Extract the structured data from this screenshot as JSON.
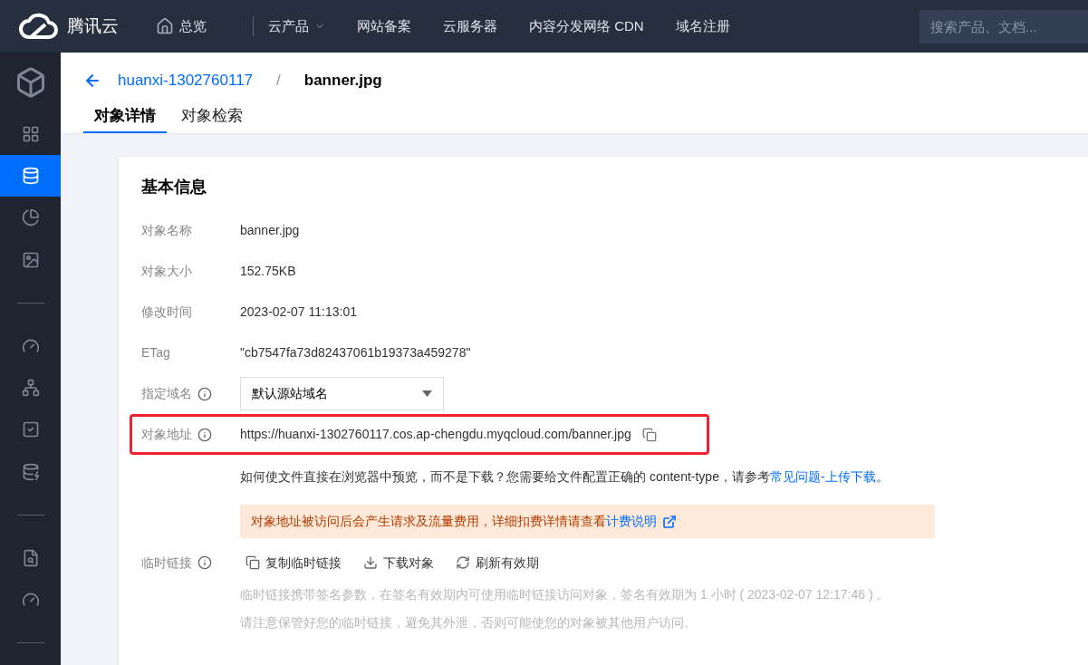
{
  "topbar": {
    "logo": "腾讯云",
    "nav": [
      {
        "label": "总览",
        "kind": "home"
      },
      {
        "kind": "divider"
      },
      {
        "label": "云产品",
        "kind": "dropdown"
      },
      {
        "label": "网站备案",
        "kind": "plain"
      },
      {
        "label": "云服务器",
        "kind": "plain"
      },
      {
        "label": "内容分发网络 CDN",
        "kind": "plain"
      },
      {
        "label": "域名注册",
        "kind": "plain"
      }
    ],
    "search": {
      "placeholder": "搜索产品、文档..."
    }
  },
  "sidebar": {
    "items": [
      {
        "kind": "logo",
        "selected": false
      },
      {
        "kind": "icon",
        "selected": false
      },
      {
        "kind": "icon",
        "selected": true
      },
      {
        "kind": "icon",
        "selected": false
      },
      {
        "kind": "icon",
        "selected": false
      },
      {
        "kind": "divider"
      },
      {
        "kind": "icon",
        "selected": false
      },
      {
        "kind": "icon",
        "selected": false
      },
      {
        "kind": "icon",
        "selected": false
      },
      {
        "kind": "icon",
        "selected": false
      },
      {
        "kind": "divider"
      },
      {
        "kind": "icon",
        "selected": false
      },
      {
        "kind": "icon",
        "selected": false
      },
      {
        "kind": "divider"
      }
    ]
  },
  "breadcrumb": {
    "bucket": "huanxi-1302760117",
    "separator": "/",
    "current": "banner.jpg"
  },
  "tabs": [
    {
      "label": "对象详情",
      "selected": true
    },
    {
      "label": "对象检索",
      "selected": false
    }
  ],
  "card": {
    "title": "基本信息",
    "fields": [
      {
        "kind": "text",
        "label": "对象名称",
        "value": "banner.jpg"
      },
      {
        "kind": "text",
        "label": "对象大小",
        "value": "152.75KB"
      },
      {
        "kind": "text",
        "label": "修改时间",
        "value": "2023-02-07 11:13:01"
      },
      {
        "kind": "text",
        "label": "ETag",
        "value": "\"cb7547fa73d82437061b19373a459278\""
      },
      {
        "kind": "select",
        "label": "指定域名",
        "info": true,
        "value": "默认源站域名"
      },
      {
        "kind": "url",
        "label": "对象地址",
        "info": true,
        "highlighted": true,
        "value": "https://huanxi-1302760117.cos.ap-chengdu.myqcloud.com/banner.jpg"
      }
    ],
    "hint": {
      "text": "如何使文件直接在浏览器中预览，而不是下载？您需要给文件配置正确的 content-type，请参考",
      "link": "常见问题-上传下载",
      "suffix": "。"
    },
    "warning": {
      "text": "对象地址被访问后会产生请求及流量费用，详细扣费详情请查看",
      "link": "计费说明"
    },
    "temp_link": {
      "label": "临时链接",
      "info": true,
      "actions": [
        {
          "kind": "copy",
          "label": "复制临时链接"
        },
        {
          "kind": "download",
          "label": "下载对象"
        },
        {
          "kind": "refresh",
          "label": "刷新有效期"
        }
      ],
      "notes": [
        "临时链接携带签名参数，在签名有效期内可使用临时链接访问对象，签名有效期为 1 小时 ( 2023-02-07 12:17:46 ) 。",
        "请注意保管好您的临时链接，避免其外泄，否则可能使您的对象被其他用户访问。"
      ]
    }
  }
}
